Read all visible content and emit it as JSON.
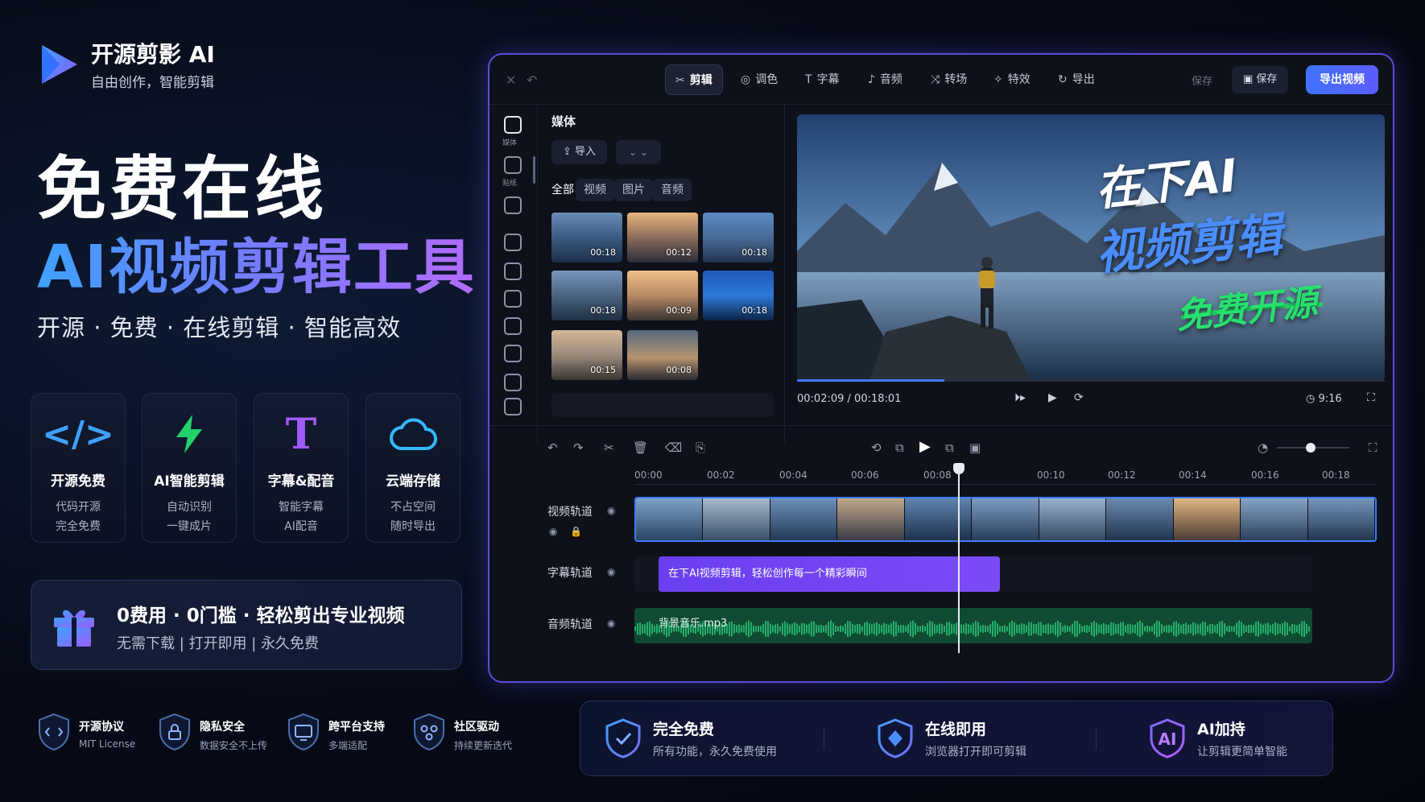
{
  "brand": {
    "name": "开源剪影 AI",
    "tagline": "自由创作，智能剪辑"
  },
  "hero": {
    "line1": "免费在线",
    "line2": "AI视频剪辑工具",
    "line3": "开源 · 免费 · 在线剪辑 · 智能高效"
  },
  "features": [
    {
      "icon": "code-icon",
      "title": "开源免费",
      "sub1": "代码开源",
      "sub2": "完全免费",
      "color": "#3fa1ff"
    },
    {
      "icon": "lightning-icon",
      "title": "AI智能剪辑",
      "sub1": "自动识别",
      "sub2": "一键成片",
      "color": "#22d36b"
    },
    {
      "icon": "text-icon",
      "title": "字幕&配音",
      "sub1": "智能字幕",
      "sub2": "AI配音",
      "color": "#a25cff"
    },
    {
      "icon": "cloud-icon",
      "title": "云端存储",
      "sub1": "不占空间",
      "sub2": "随时导出",
      "color": "#35b8ff"
    }
  ],
  "promo": {
    "title": "0费用 · 0门槛 · 轻松剪出专业视频",
    "sub": "无需下载 | 打开即用 | 永久免费"
  },
  "badges": [
    {
      "icon": "shield-code-icon",
      "title": "开源协议",
      "sub": "MIT License"
    },
    {
      "icon": "shield-lock-icon",
      "title": "隐私安全",
      "sub": "数据安全不上传"
    },
    {
      "icon": "monitor-icon",
      "title": "跨平台支持",
      "sub": "多端适配"
    },
    {
      "icon": "community-icon",
      "title": "社区驱动",
      "sub": "持续更新迭代"
    }
  ],
  "strip": [
    {
      "icon": "shield-check-icon",
      "title": "完全免费",
      "sub": "所有功能，永久免费使用"
    },
    {
      "icon": "diamond-icon",
      "title": "在线即用",
      "sub": "浏览器打开即可剪辑"
    },
    {
      "icon": "ai-icon",
      "title": "AI加持",
      "sub": "让剪辑更简单智能",
      "icon_text": "AI"
    }
  ],
  "app": {
    "tabs": [
      {
        "icon": "scissors-icon",
        "glyph": "✂",
        "label": "剪辑",
        "active": true
      },
      {
        "icon": "palette-icon",
        "glyph": "◎",
        "label": "调色"
      },
      {
        "icon": "text-tool-icon",
        "glyph": "T",
        "label": "字幕"
      },
      {
        "icon": "music-icon",
        "glyph": "♪",
        "label": "音频"
      },
      {
        "icon": "transition-icon",
        "glyph": "⤨",
        "label": "转场"
      },
      {
        "icon": "sparkle-icon",
        "glyph": "✧",
        "label": "特效"
      },
      {
        "icon": "export-tab-icon",
        "glyph": "↻",
        "label": "导出"
      }
    ],
    "unknown_label": "保存",
    "save_label": "保存",
    "export_label": "导出视频",
    "sidebar_labels": [
      "媒体",
      "贴纸"
    ],
    "media": {
      "title": "媒体",
      "import_label": "导入",
      "filters": [
        "全部",
        "视频",
        "图片",
        "音频"
      ],
      "thumbs": [
        "00:18",
        "00:12",
        "00:18",
        "00:18",
        "00:09",
        "00:18",
        "00:15",
        "00:08"
      ]
    },
    "preview": {
      "text1": "在下AI",
      "text2": "视频剪辑",
      "text3": "免费开源",
      "current_time": "00:02:09",
      "total_time": "00:18:01",
      "progress": 0.25,
      "ratio": "9:16"
    },
    "timeline": {
      "ruler": [
        "00:00",
        "00:02",
        "00:04",
        "00:06",
        "00:08",
        "00:10",
        "00:12",
        "00:14",
        "00:16",
        "00:18"
      ],
      "tracks": {
        "video": "视频轨道",
        "subtitle": "字幕轨道",
        "audio": "音频轨道"
      },
      "subtitle_text": "在下AI视频剪辑，轻松创作每一个精彩瞬间",
      "audio_file": "背景音乐.mp3"
    }
  }
}
